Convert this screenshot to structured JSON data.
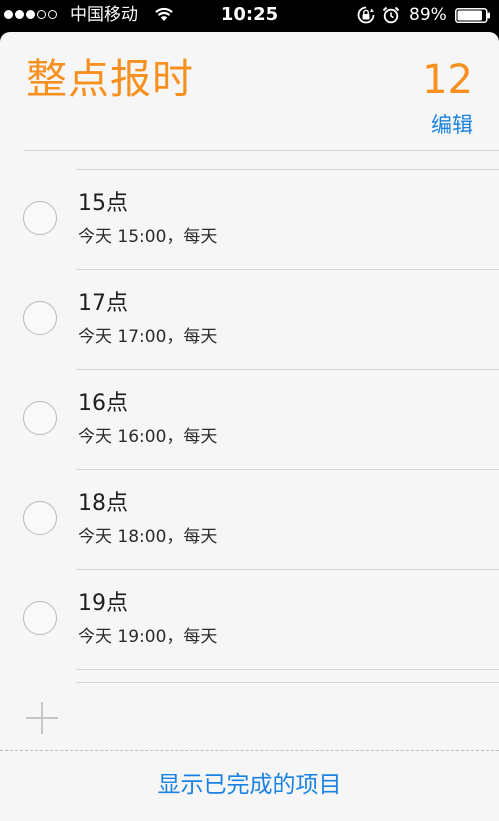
{
  "status_bar": {
    "carrier": "中国移动",
    "time": "10:25",
    "battery_percent": "89%",
    "battery_level": 0.89,
    "signal_bars_filled": 3,
    "signal_bars_total": 5,
    "icons": [
      "wifi-icon",
      "rotation-lock-icon",
      "alarm-icon",
      "battery-icon"
    ]
  },
  "list": {
    "title": "整点报时",
    "count": "12",
    "edit_label": "编辑",
    "accent_color": "#f7901e",
    "link_color": "#1a82e2"
  },
  "reminders": [
    {
      "title": "15点",
      "subtitle": "今天 15:00，每天"
    },
    {
      "title": "17点",
      "subtitle": "今天 17:00，每天"
    },
    {
      "title": "16点",
      "subtitle": "今天 16:00，每天"
    },
    {
      "title": "18点",
      "subtitle": "今天 18:00，每天"
    },
    {
      "title": "19点",
      "subtitle": "今天 19:00，每天"
    }
  ],
  "footer": {
    "show_completed_label": "显示已完成的项目",
    "add_icon": "plus-icon"
  }
}
